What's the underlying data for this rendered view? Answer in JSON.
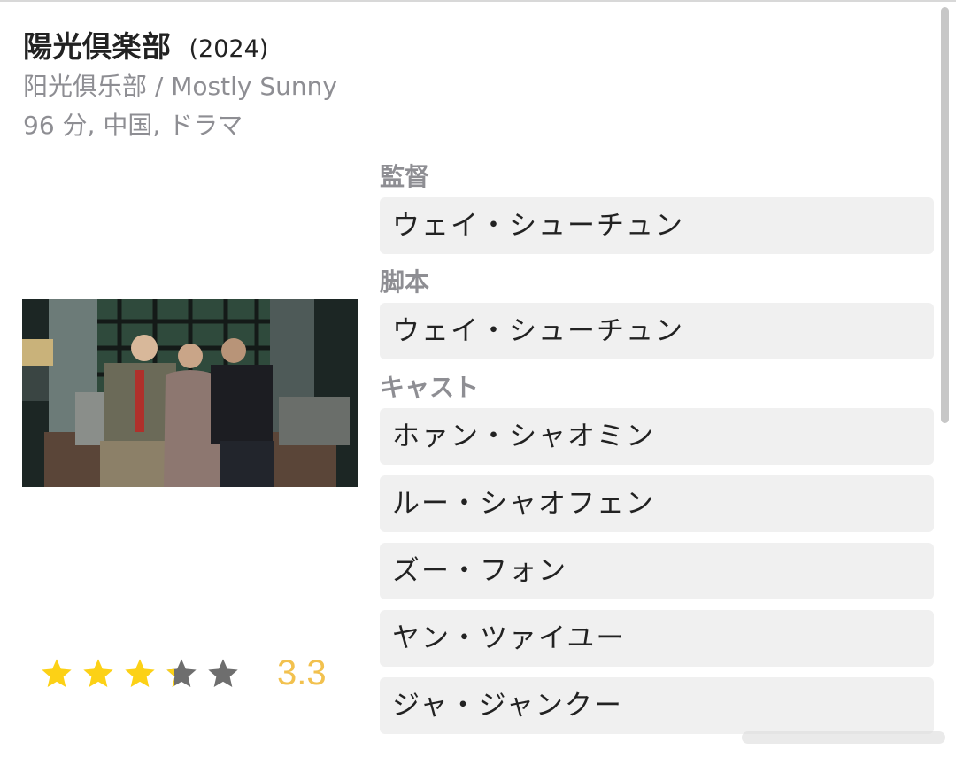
{
  "header": {
    "title": "陽光倶楽部",
    "year": "(2024)",
    "subtitle": "阳光俱乐部 /  Mostly Sunny",
    "meta": "96 分, 中国, ドラマ"
  },
  "rating": {
    "value": "3.3",
    "stars_filled": 3.3,
    "stars_total": 5,
    "star_color": "#fcd116",
    "empty_star_color": "#6e6e6e"
  },
  "credits": {
    "director_label": "監督",
    "director": "ウェイ・シューチュン",
    "writer_label": "脚本",
    "writer": "ウェイ・シューチュン",
    "cast_label": "キャスト",
    "cast": [
      "ホァン・シャオミン",
      "ルー・シャオフェン",
      "ズー・フォン",
      "ヤン・ツァイユー",
      "ジャ・ジャンクー"
    ]
  },
  "colors": {
    "label_gray": "#8e8e93",
    "pill_bg": "#f0f0f0",
    "rating_text": "#f2c14e"
  }
}
